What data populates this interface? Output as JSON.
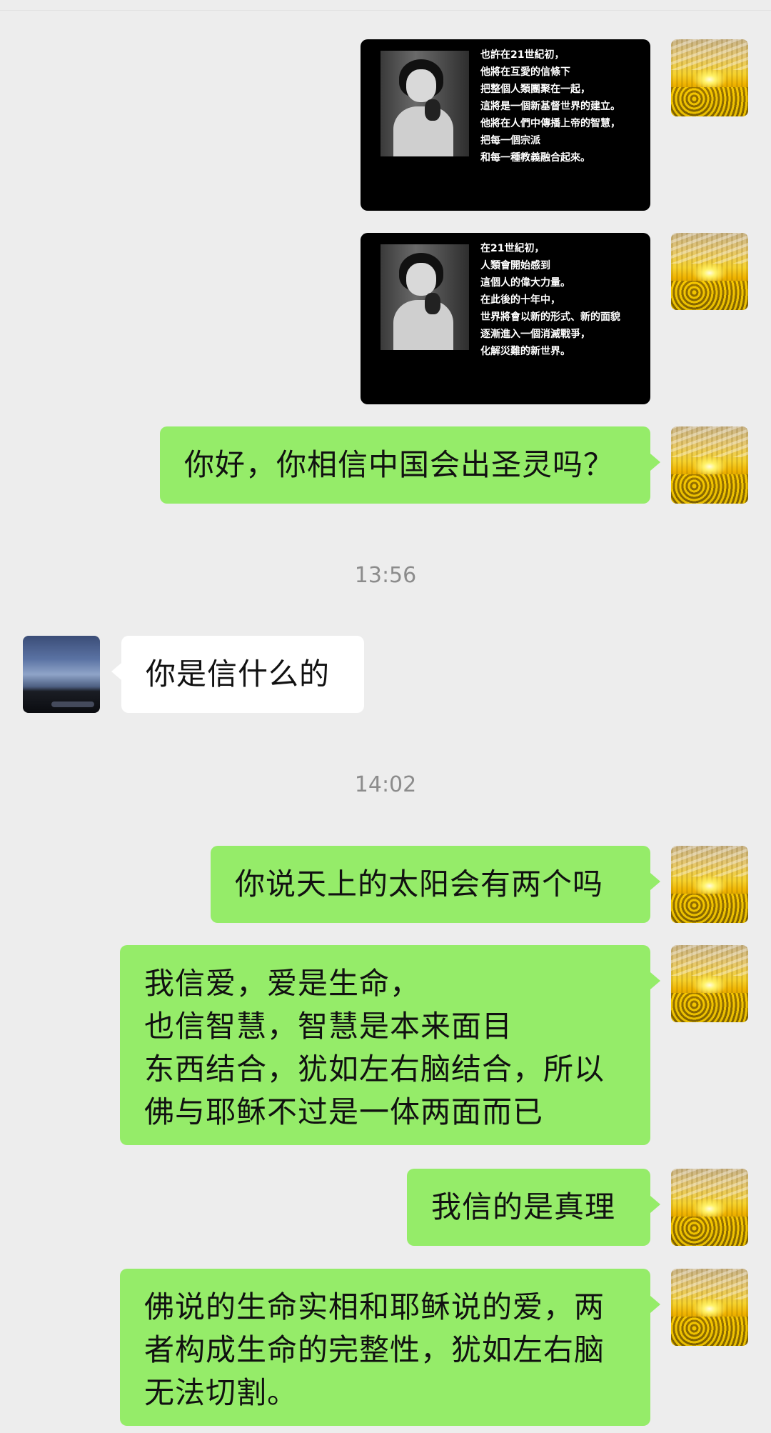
{
  "image_messages": [
    {
      "caption": "也許在21世紀初，\n他將在互愛的信條下\n把整個人類團聚在一起，\n這將是一個新基督世界的建立。\n他將在人們中傳播上帝的智慧，\n把每一個宗派\n和每一種教義融合起來。"
    },
    {
      "caption": "在21世紀初，\n人類會開始感到\n這個人的偉大力量。\n在此後的十年中，\n世界將會以新的形式、新的面貌\n逐漸進入一個消滅戰爭，\n化解災難的新世界。"
    }
  ],
  "messages": [
    {
      "text": "你好，你相信中国会出圣灵吗？"
    },
    {
      "text": "你是信什么的"
    },
    {
      "text": "你说天上的太阳会有两个吗"
    },
    {
      "text": "我信爱，爱是生命，\n也信智慧，智慧是本来面目\n东西结合，犹如左右脑结合，所以\n佛与耶稣不过是一体两面而已"
    },
    {
      "text": "我信的是真理"
    },
    {
      "text": "佛说的生命实相和耶稣说的爱，两\n者构成生命的完整性，犹如左右脑\n无法切割。"
    }
  ],
  "timestamps": [
    "13:56",
    "14:02"
  ]
}
